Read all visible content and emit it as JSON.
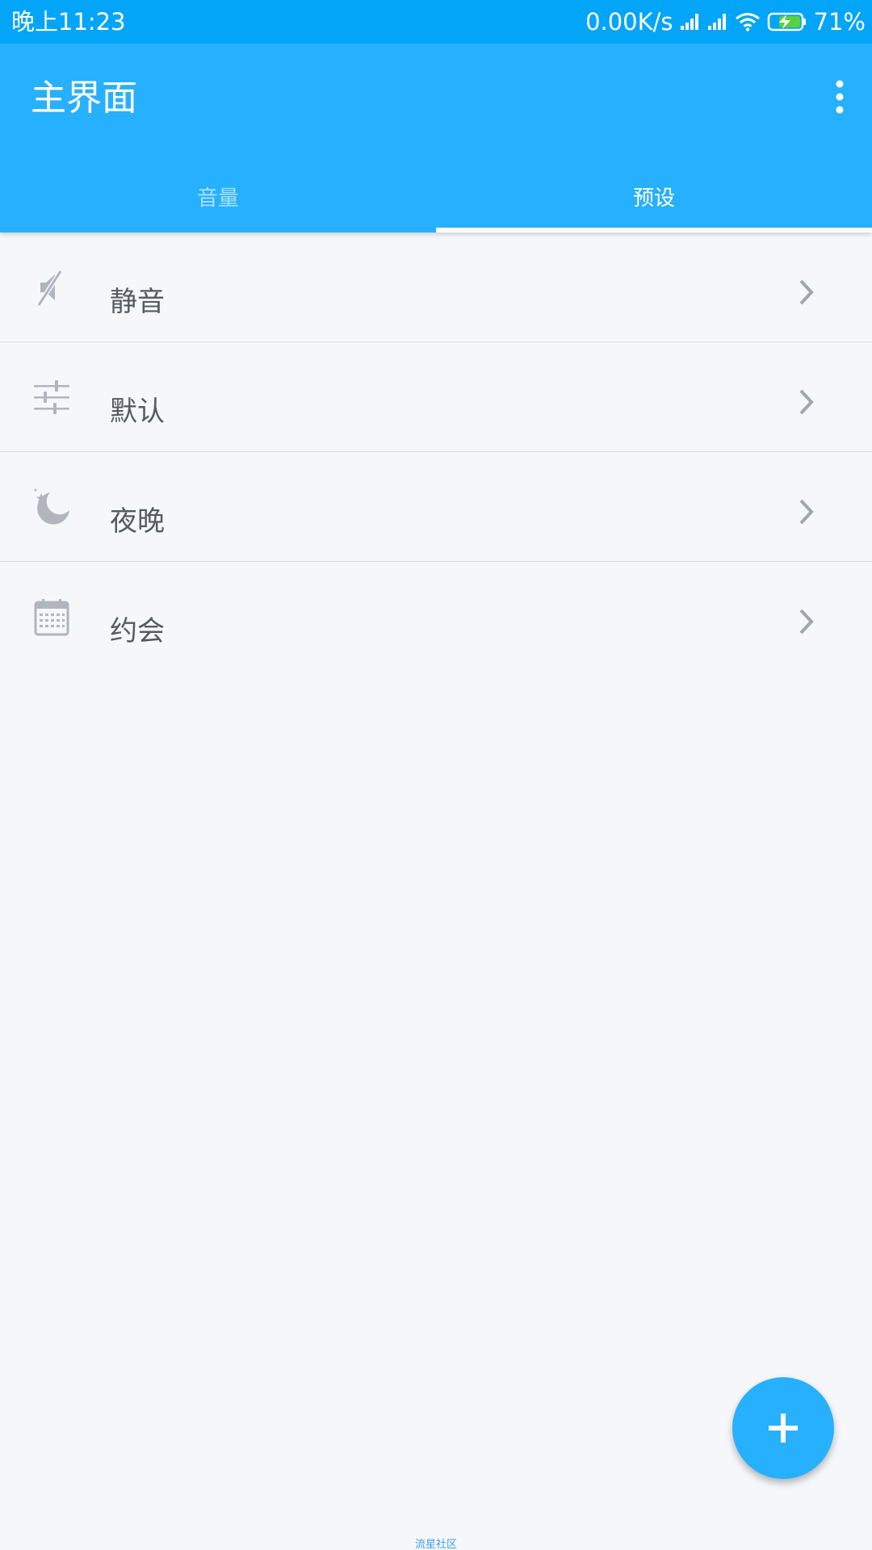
{
  "status_bar": {
    "time": "晚上11:23",
    "network_speed": "0.00K/s",
    "battery": "71%",
    "icons": [
      "signal-icon",
      "signal-icon",
      "wifi-icon",
      "battery-charging-icon"
    ]
  },
  "app_bar": {
    "title": "主界面",
    "menu_icon": "more-vert-icon"
  },
  "tabs": [
    {
      "label": "音量",
      "active": false
    },
    {
      "label": "预设",
      "active": true
    }
  ],
  "presets": [
    {
      "label": "静音",
      "icon": "mute-icon"
    },
    {
      "label": "默认",
      "icon": "equalizer-icon"
    },
    {
      "label": "夜晚",
      "icon": "moon-icon"
    },
    {
      "label": "约会",
      "icon": "calendar-icon"
    }
  ],
  "fab": {
    "icon": "add-icon"
  },
  "watermark": "流星社区",
  "colors": {
    "status_bar": "#03a5f8",
    "app_bar": "#27b0fd",
    "background": "#f5f7fa",
    "icon_gray": "#b0b6bc",
    "text": "#555a60"
  }
}
